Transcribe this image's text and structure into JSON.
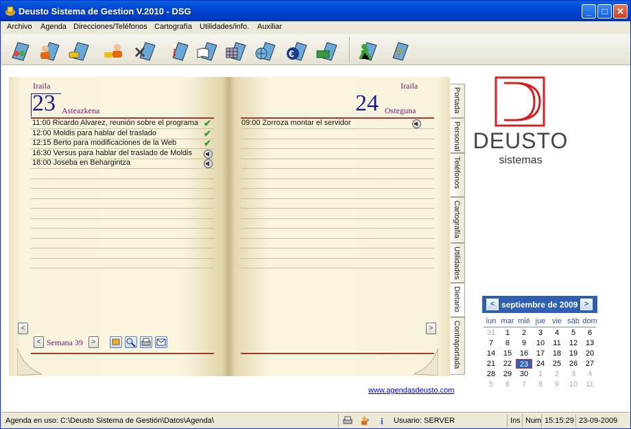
{
  "window": {
    "title": "Deusto Sistema de Gestion V.2010 - DSG",
    "minimize": "_",
    "maximize": "□",
    "close": "✕"
  },
  "menu": [
    "Archivo",
    "Agenda",
    "Direcciones/Teléfonos",
    "Cartografía",
    "Utilidades/info.",
    "Auxiliar"
  ],
  "toolbar": {
    "icons": [
      "people-icon",
      "user-icon",
      "phone-book-icon",
      "contacts-icon",
      "map-icon",
      "info-icon",
      "book-icon",
      "calendar-grid-icon",
      "globe-icon",
      "euro-icon",
      "money-icon",
      "exit-icon",
      "help-icon"
    ]
  },
  "agenda": {
    "left": {
      "month": "Iraila",
      "day": "23",
      "weekday": "Asteazkena",
      "events": [
        {
          "text": "11:00 Ricardo Alvarez, reunión sobre el programa",
          "icon": "check"
        },
        {
          "text": "12:00 Moldis para hablar del traslado",
          "icon": "check"
        },
        {
          "text": "12:15 Berto para modificaciones de la Web",
          "icon": "check"
        },
        {
          "text": "16:30 Versus para hablar del traslado de Moldis",
          "icon": "speaker"
        },
        {
          "text": "18:00 Joseba en Behargintza",
          "icon": "speaker"
        }
      ]
    },
    "right": {
      "month": "Iraila",
      "day": "24",
      "weekday": "Osteguna",
      "events": [
        {
          "text": "09:00 Zorroza montar el servidor",
          "icon": "speaker"
        }
      ]
    },
    "week_label": "Semana 39",
    "prev": "<",
    "next": ">"
  },
  "tabs": [
    "Portada",
    "Personal",
    "Teléfonos",
    "Cartografía",
    "Utilidades",
    "Dietario",
    "Contraportada"
  ],
  "logo": {
    "name": "DEUSTO",
    "sub": "sistemas"
  },
  "link": "www.agendasdeusto.com",
  "calendar": {
    "title": "septiembre de 2009",
    "prev": "<",
    "next": ">",
    "dow": [
      "lun",
      "mar",
      "mié",
      "jue",
      "vie",
      "sáb",
      "dom"
    ],
    "weeks": [
      [
        "31",
        "1",
        "2",
        "3",
        "4",
        "5",
        "6"
      ],
      [
        "7",
        "8",
        "9",
        "10",
        "11",
        "12",
        "13"
      ],
      [
        "14",
        "15",
        "16",
        "17",
        "18",
        "19",
        "20"
      ],
      [
        "21",
        "22",
        "23",
        "24",
        "25",
        "26",
        "27"
      ],
      [
        "28",
        "29",
        "30",
        "1",
        "2",
        "3",
        "4"
      ],
      [
        "5",
        "6",
        "7",
        "8",
        "9",
        "10",
        "11"
      ]
    ],
    "today": "23"
  },
  "status": {
    "path": "Agenda en uso: C:\\Deusto Sistema de Gestión\\Datos\\Agenda\\",
    "user": "Usuario: SERVER",
    "ins": "Ins",
    "num": "Num",
    "time": "15:15:29",
    "date": "23-09-2009"
  },
  "colors": {
    "titlebar": "#0046d5",
    "accent": "#2f5fb0",
    "purple": "#6a1a7a",
    "logo_red": "#d42020"
  }
}
